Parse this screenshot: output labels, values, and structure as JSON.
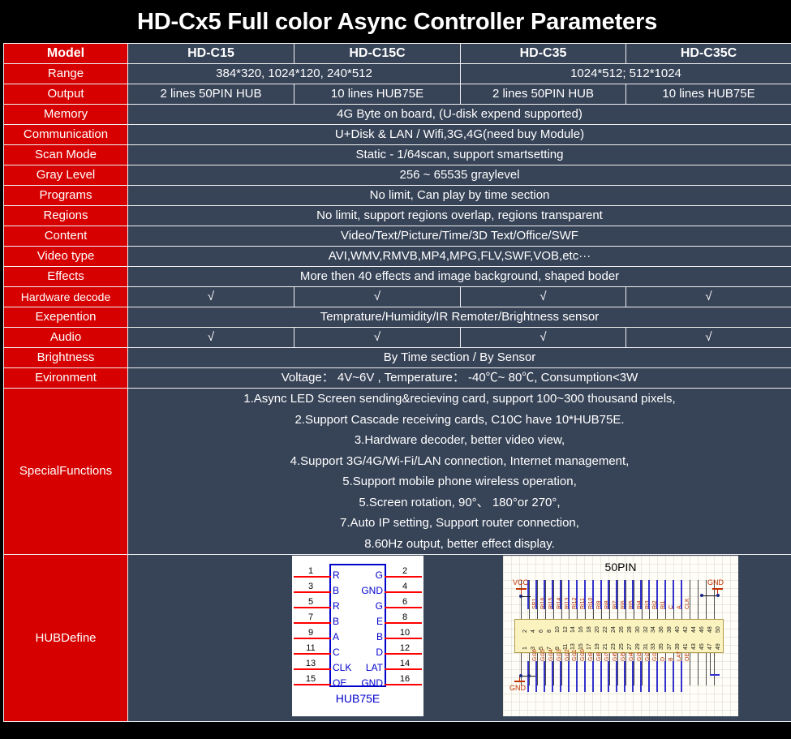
{
  "title": "HD-Cx5 Full color Async Controller Parameters",
  "colors": {
    "label_red": "#d60000",
    "value_navy": "#374357",
    "title_black": "#000000",
    "grid_white": "#f2f2f2"
  },
  "columns": [
    "HD-C15",
    "HD-C15C",
    "HD-C35",
    "HD-C35C"
  ],
  "rows": [
    {
      "label": "Model",
      "type": "four",
      "values": [
        "HD-C15",
        "HD-C15C",
        "HD-C35",
        "HD-C35C"
      ],
      "bold": true
    },
    {
      "label": "Range",
      "type": "two",
      "values": [
        "384*320,  1024*120,  240*512",
        "1024*512;  512*1024"
      ]
    },
    {
      "label": "Output",
      "type": "four",
      "values": [
        "2 lines 50PIN HUB",
        "10 lines HUB75E",
        "2 lines 50PIN HUB",
        "10 lines HUB75E"
      ]
    },
    {
      "label": "Memory",
      "type": "span",
      "values": [
        "4G Byte on board,  (U-disk expend supported)"
      ]
    },
    {
      "label": "Communication",
      "type": "span",
      "values": [
        "U+Disk & LAN / Wifi,3G,4G(need buy Module)"
      ]
    },
    {
      "label": "Scan Mode",
      "type": "span",
      "values": [
        "Static - 1/64scan,  support smartsetting"
      ]
    },
    {
      "label": "Gray Level",
      "type": "span",
      "values": [
        "256 ~ 65535 graylevel"
      ]
    },
    {
      "label": "Programs",
      "type": "span",
      "values": [
        "No limit,  Can play by time section"
      ]
    },
    {
      "label": "Regions",
      "type": "span",
      "values": [
        "No limit,  support regions overlap,  regions transparent"
      ]
    },
    {
      "label": "Content",
      "type": "span",
      "values": [
        "Video/Text/Picture/Time/3D Text/Office/SWF"
      ]
    },
    {
      "label": "Video type",
      "type": "span",
      "values": [
        "AVI,WMV,RMVB,MP4,MPG,FLV,SWF,VOB,etc···"
      ]
    },
    {
      "label": "Effects",
      "type": "span",
      "values": [
        "More then 40 effects and image background, shaped boder"
      ]
    },
    {
      "label": "Hardware decode",
      "type": "four",
      "values": [
        "√",
        "√",
        "√",
        "√"
      ]
    },
    {
      "label": "Exepention",
      "type": "span",
      "values": [
        "Temprature/Humidity/IR Remoter/Brightness sensor"
      ]
    },
    {
      "label": "Audio",
      "type": "four",
      "values": [
        "√",
        "√",
        "√",
        "√"
      ]
    },
    {
      "label": "Brightness",
      "type": "span",
      "values": [
        "By Time section / By Sensor"
      ]
    },
    {
      "label": "Evironment",
      "type": "span",
      "values": [
        "Voltage： 4V~6V ,  Temperature： -40℃~ 80℃,   Consumption<3W"
      ]
    }
  ],
  "special_functions": {
    "label": "SpecialFunctions",
    "lines": [
      "1.Async LED Screen sending&recieving card, support 100~300 thousand pixels,",
      "2.Support Cascade receiving cards, C10C have 10*HUB75E.",
      "3.Hardware decoder, better video view,",
      "4.Support 3G/4G/Wi-Fi/LAN connection,   Internet management,",
      "5.Support mobile phone wireless operation,",
      "5.Screen rotation,  90°、 180°or 270°,",
      "7.Auto IP setting, Support router connection,",
      "8.60Hz output, better effect display."
    ]
  },
  "hub_define": {
    "label": "HUBDefine",
    "hub75e": {
      "caption": "HUB75E",
      "odd_pins": [
        "1",
        "3",
        "5",
        "7",
        "9",
        "11",
        "13",
        "15"
      ],
      "even_pins": [
        "2",
        "4",
        "6",
        "8",
        "10",
        "12",
        "14",
        "16"
      ],
      "left_signals": [
        "R",
        "B",
        "R",
        "B",
        "A",
        "C",
        "CLK",
        "OE"
      ],
      "right_signals": [
        "G",
        "GND",
        "G",
        "E",
        "B",
        "D",
        "LAT",
        "GND"
      ]
    },
    "pin50": {
      "caption": "50PIN",
      "vcc_label": "VCC",
      "gnd_label": "GND",
      "gnd_right_label": "GND",
      "top_signals": [
        "SR1",
        "Ri16",
        "Ri15",
        "Ri14",
        "Ri13",
        "Ri12",
        "Ri11",
        "Ri10",
        "Ri9",
        "Ri8",
        "Ri7",
        "Ri6",
        "Ri5",
        "Ri4",
        "Ri3",
        "Ri2",
        "Ri1",
        "C",
        "A",
        "CLK"
      ],
      "bottom_signals": [
        "Gi16",
        "Gi15",
        "Gi14",
        "Gi13",
        "Gi12",
        "Gi11",
        "Gi10",
        "Gi9",
        "Gi8",
        "Gi7",
        "Gi6",
        "Gi5",
        "Gi4",
        "Gi3",
        "Gi2",
        "Gi1",
        "D",
        "B",
        "LAT",
        "OE"
      ],
      "top_numbers": [
        "2",
        "4",
        "6",
        "8",
        "10",
        "12",
        "14",
        "16",
        "18",
        "20",
        "22",
        "24",
        "26",
        "28",
        "30",
        "32",
        "34",
        "36",
        "38",
        "40",
        "42",
        "44",
        "46",
        "48",
        "50"
      ],
      "bottom_numbers": [
        "1",
        "3",
        "5",
        "7",
        "9",
        "11",
        "13",
        "15",
        "17",
        "19",
        "21",
        "23",
        "25",
        "27",
        "29",
        "31",
        "33",
        "35",
        "37",
        "39",
        "41",
        "43",
        "45",
        "47",
        "49"
      ]
    }
  }
}
